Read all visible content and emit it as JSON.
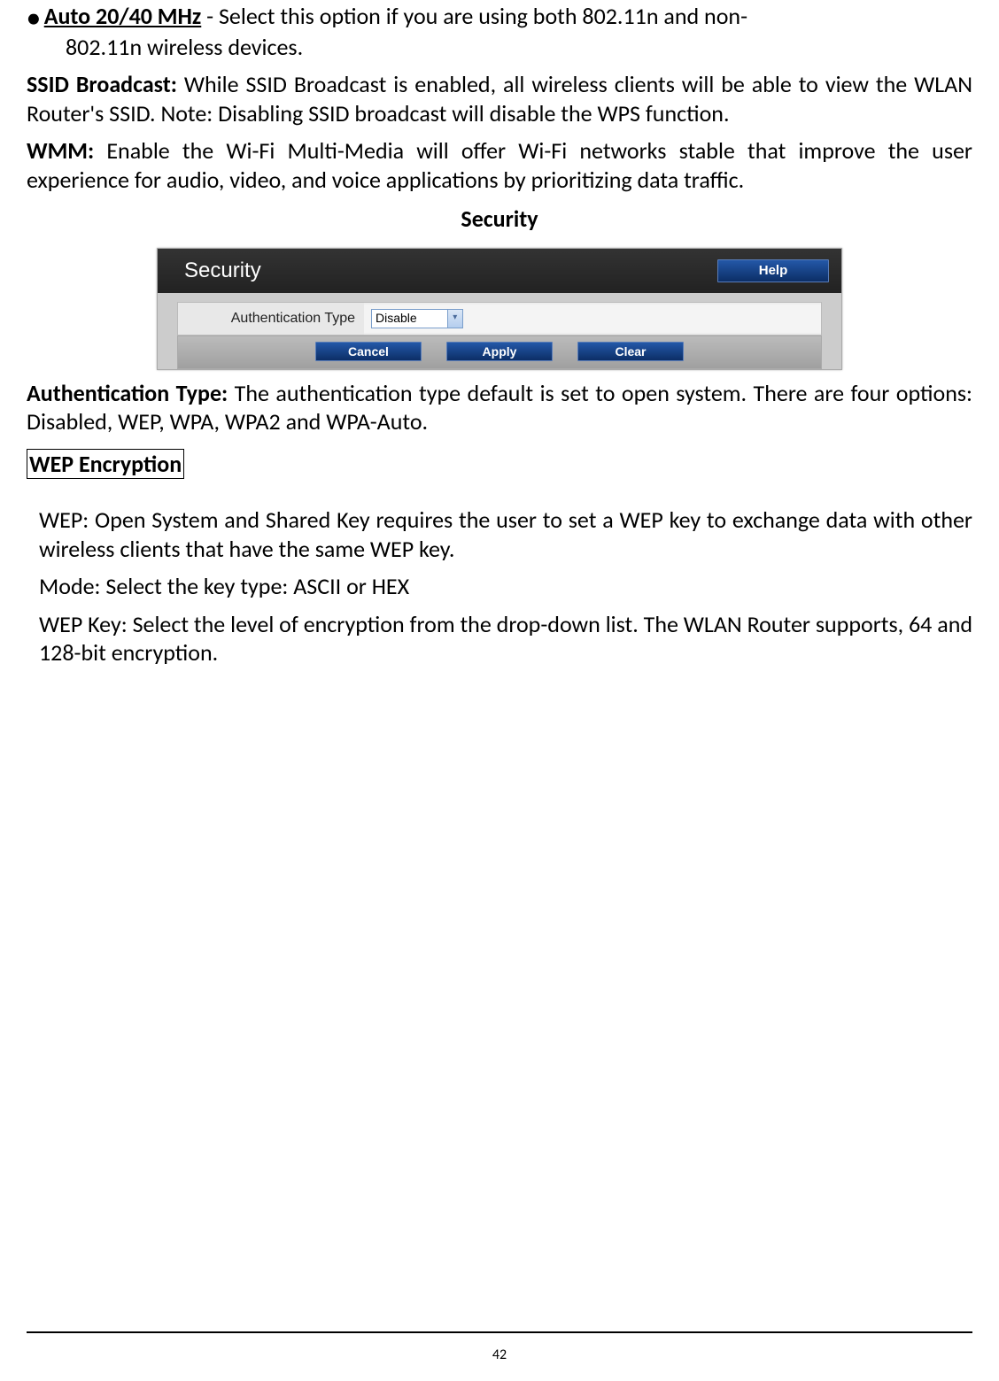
{
  "bullet": {
    "title": "Auto 20/40 MHz",
    "line1": " - Select this option if you are using both 802.11n and non-",
    "line2": "802.11n wireless devices."
  },
  "ssid": {
    "term": "SSID Broadcast:",
    "text": " While SSID Broadcast is enabled, all wireless clients will be able to view the WLAN Router's SSID. Note: Disabling SSID broadcast will disable the WPS function."
  },
  "wmm": {
    "term": "WMM:",
    "text": " Enable the Wi-Fi Multi-Media will offer Wi-Fi networks stable that improve the user experience for audio, video, and voice applications by prioritizing data traffic."
  },
  "security_heading": "Security",
  "figure": {
    "panel_title": "Security",
    "help_label": "Help",
    "auth_label": "Authentication Type",
    "auth_value": "Disable",
    "cancel": "Cancel",
    "apply": "Apply",
    "clear": "Clear"
  },
  "auth_para": {
    "term": "Authentication Type:",
    "text": "  The authentication type default is set to open system. There are four options: Disabled, WEP, WPA, WPA2 and WPA-Auto."
  },
  "wep_heading": "WEP Encryption",
  "wep": {
    "term": "WEP:",
    "text": " Open System and Shared Key requires the user to set a WEP key to exchange data with other wireless clients that have the same WEP key."
  },
  "mode": {
    "term": "Mode:",
    "text": " Select the key type: ASCII or HEX"
  },
  "wepkey": {
    "term": "WEP Key:",
    "text": " Select the level of encryption from the drop-down list. The WLAN Router supports, 64 and 128-bit encryption."
  },
  "page_number": "42"
}
